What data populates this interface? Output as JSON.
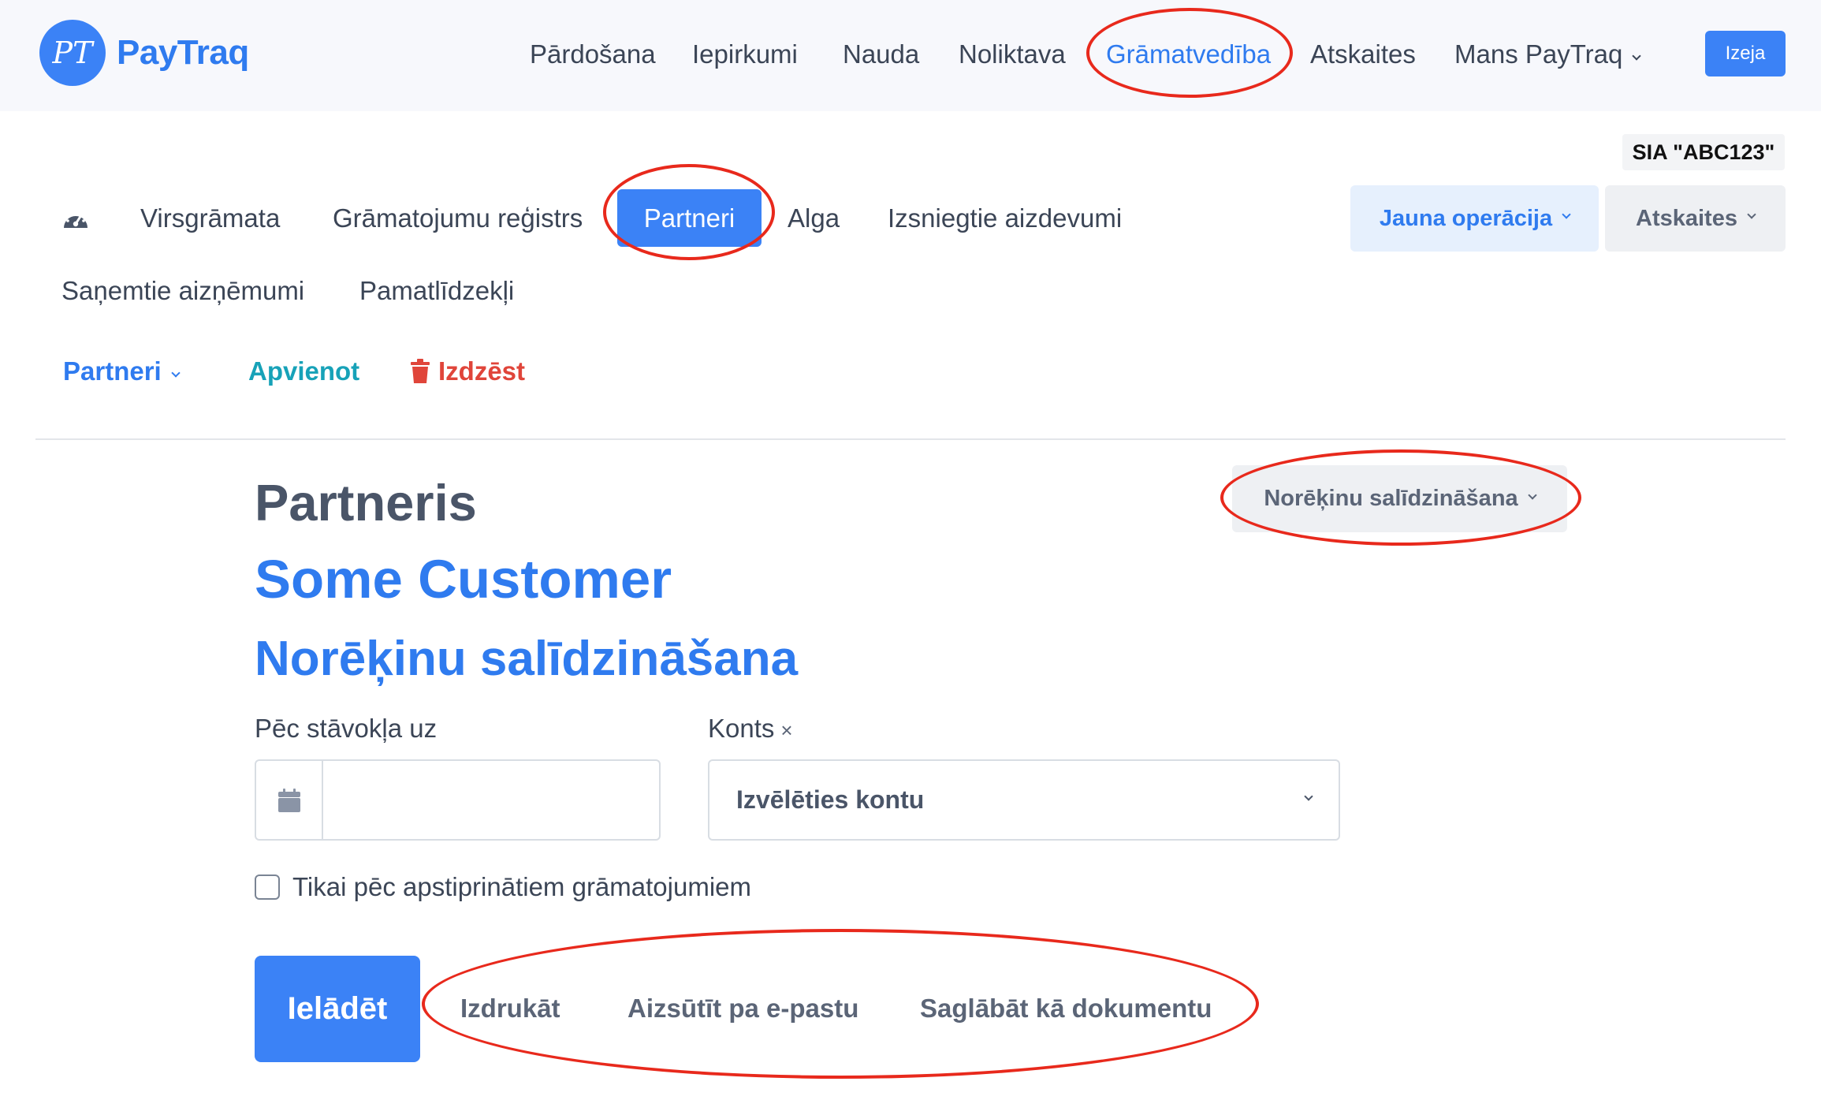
{
  "logo": {
    "mark": "PT",
    "name": "PayTraq"
  },
  "main_nav": {
    "items": [
      "Pārdošana",
      "Iepirkumi",
      "Nauda",
      "Noliktava",
      "Grāmatvedība",
      "Atskaites",
      "Mans PayTraq"
    ],
    "active": "Grāmatvedība",
    "exit_label": "Izeja"
  },
  "company": "SIA \"ABC123\"",
  "sub_nav": {
    "items": [
      "Virsgrāmata",
      "Grāmatojumu reģistrs",
      "Partneri",
      "Alga",
      "Izsniegtie aizdevumi",
      "Saņemtie aizņēmumi",
      "Pamatlīdzekļi"
    ],
    "active": "Partneri",
    "new_operation": "Jauna operācija",
    "reports": "Atskaites"
  },
  "actions": {
    "partners": "Partneri",
    "merge": "Apvienot",
    "delete": "Izdzēst"
  },
  "page": {
    "section": "Partneris",
    "partner_name": "Some Customer",
    "subtitle": "Norēķinu salīdzināšana",
    "recon_dropdown": "Norēķinu salīdzināšana"
  },
  "form": {
    "date_label": "Pēc stāvokļa uz",
    "date_value": "",
    "account_label": "Konts",
    "account_clear": "×",
    "account_placeholder": "Izvēlēties kontu",
    "checkbox_label": "Tikai pēc apstiprinātiem grāmatojumiem",
    "load_button": "Ielādēt",
    "print": "Izdrukāt",
    "email": "Aizsūtīt pa e-pastu",
    "save_doc": "Saglābāt kā dokumentu"
  },
  "colors": {
    "accent": "#3b82f6",
    "danger": "#e0453a",
    "teal": "#17a2b8",
    "annotation": "#e8291c"
  }
}
